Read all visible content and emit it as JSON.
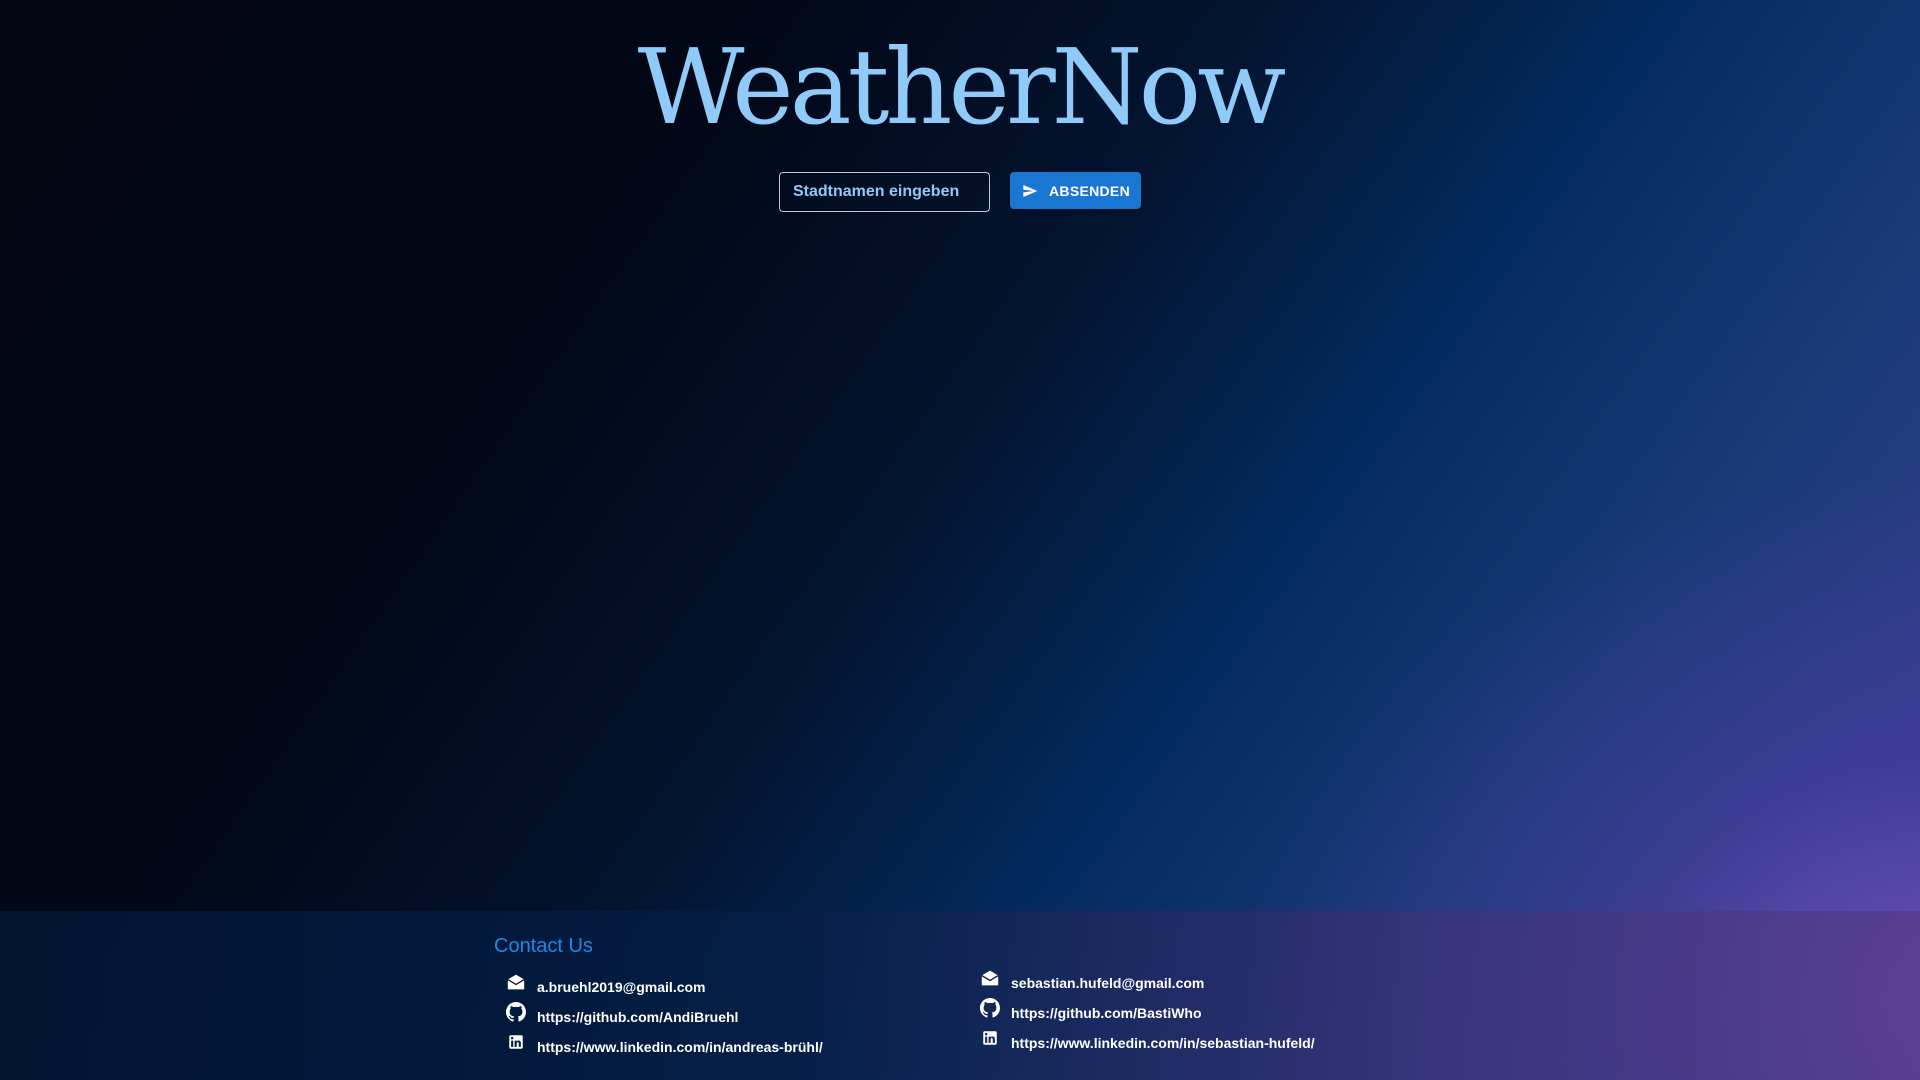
{
  "app": {
    "title": "WeatherNow"
  },
  "search": {
    "placeholder": "Stadtnamen eingeben",
    "value": "",
    "submit_label": "ABSENDEN",
    "submit_icon": "send-icon"
  },
  "footer": {
    "heading": "Contact Us",
    "contacts": [
      {
        "email": "a.bruehl2019@gmail.com",
        "github": "https://github.com/AndiBruehl",
        "linkedin": "https://www.linkedin.com/in/andreas-brühl/"
      },
      {
        "email": "sebastian.hufeld@gmail.com",
        "github": "https://github.com/BastiWho",
        "linkedin": "https://www.linkedin.com/in/sebastian-hufeld/"
      }
    ],
    "icons": [
      "email-icon",
      "github-icon",
      "linkedin-icon"
    ]
  },
  "colors": {
    "title": "#90caf9",
    "accent": "#1976d2",
    "footer_heading": "#1e88e5",
    "background_dark": "#02040f",
    "background_purple": "#6a4fb0"
  }
}
